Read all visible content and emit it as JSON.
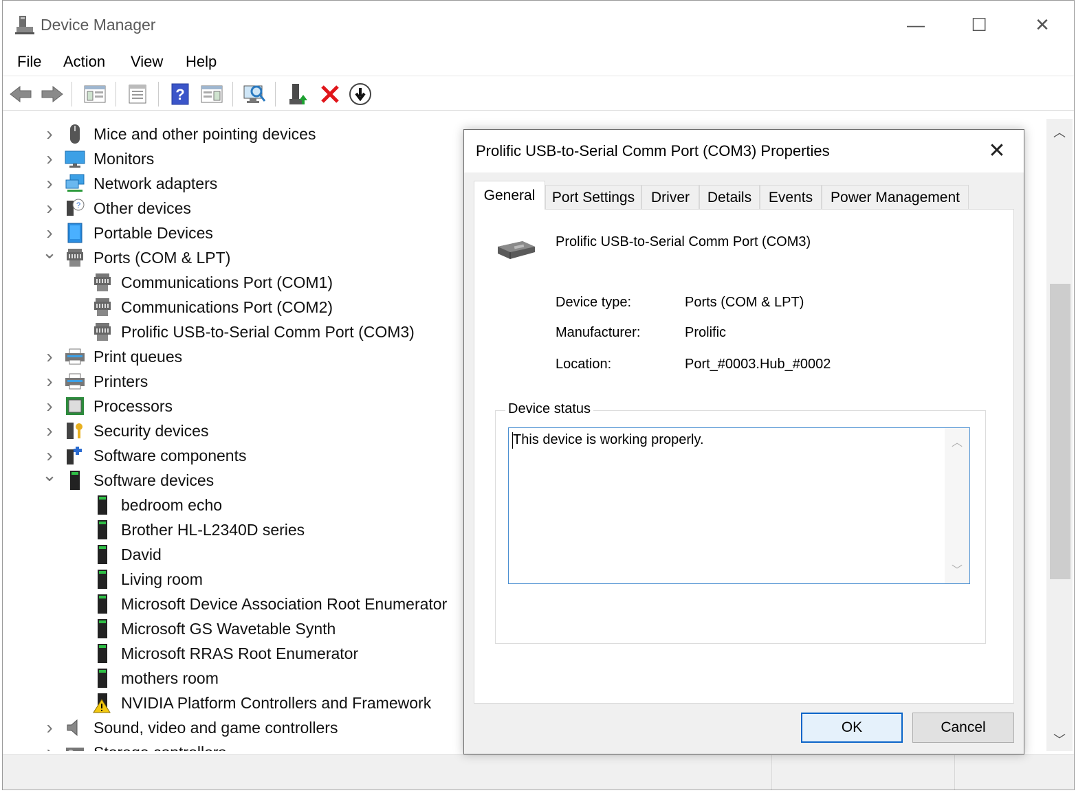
{
  "window": {
    "title": "Device Manager",
    "controls": {
      "minimize": "—",
      "maximize": "☐",
      "close": "✕"
    }
  },
  "menu": {
    "file": "File",
    "action": "Action",
    "view": "View",
    "help": "Help"
  },
  "toolbar": {
    "icons": [
      "back-icon",
      "forward-icon",
      "show-hide-console-tree-icon",
      "properties-icon",
      "help-icon",
      "action-pane-icon",
      "scan-hardware-icon",
      "update-driver-icon",
      "uninstall-icon",
      "disable-device-icon"
    ]
  },
  "tree": {
    "items": [
      {
        "label": "Mice and other pointing devices",
        "expanded": false,
        "icon": "mouse-icon"
      },
      {
        "label": "Monitors",
        "expanded": false,
        "icon": "monitor-icon"
      },
      {
        "label": "Network adapters",
        "expanded": false,
        "icon": "network-icon"
      },
      {
        "label": "Other devices",
        "expanded": false,
        "icon": "unknown-device-icon"
      },
      {
        "label": "Portable Devices",
        "expanded": false,
        "icon": "portable-device-icon"
      },
      {
        "label": "Ports (COM & LPT)",
        "expanded": true,
        "icon": "port-icon"
      },
      {
        "label": "Communications Port (COM1)",
        "child": true,
        "icon": "port-icon"
      },
      {
        "label": "Communications Port (COM2)",
        "child": true,
        "icon": "port-icon"
      },
      {
        "label": "Prolific USB-to-Serial Comm Port (COM3)",
        "child": true,
        "icon": "port-icon"
      },
      {
        "label": "Print queues",
        "expanded": false,
        "icon": "printer-icon"
      },
      {
        "label": "Printers",
        "expanded": false,
        "icon": "printer-icon"
      },
      {
        "label": "Processors",
        "expanded": false,
        "icon": "processor-icon"
      },
      {
        "label": "Security devices",
        "expanded": false,
        "icon": "security-icon"
      },
      {
        "label": "Software components",
        "expanded": false,
        "icon": "software-component-icon"
      },
      {
        "label": "Software devices",
        "expanded": true,
        "icon": "software-device-icon"
      },
      {
        "label": "bedroom echo",
        "child": true,
        "icon": "software-device-icon"
      },
      {
        "label": "Brother HL-L2340D series",
        "child": true,
        "icon": "software-device-icon"
      },
      {
        "label": "David",
        "child": true,
        "icon": "software-device-icon"
      },
      {
        "label": "Living room",
        "child": true,
        "icon": "software-device-icon"
      },
      {
        "label": "Microsoft Device Association Root Enumerator",
        "child": true,
        "icon": "software-device-icon"
      },
      {
        "label": "Microsoft GS Wavetable Synth",
        "child": true,
        "icon": "software-device-icon"
      },
      {
        "label": "Microsoft RRAS Root Enumerator",
        "child": true,
        "icon": "software-device-icon"
      },
      {
        "label": "mothers room",
        "child": true,
        "icon": "software-device-icon"
      },
      {
        "label": "NVIDIA Platform Controllers and Framework",
        "child": true,
        "icon": "warning-icon"
      },
      {
        "label": "Sound, video and game controllers",
        "expanded": false,
        "icon": "speaker-icon"
      },
      {
        "label": "Storage controllers",
        "expanded": false,
        "icon": "storage-icon"
      }
    ]
  },
  "dialog": {
    "title": "Prolific USB-to-Serial Comm Port (COM3) Properties",
    "close": "✕",
    "tabs": [
      "General",
      "Port Settings",
      "Driver",
      "Details",
      "Events",
      "Power Management"
    ],
    "active_tab": "General",
    "device_name": "Prolific USB-to-Serial Comm Port (COM3)",
    "props": {
      "device_type_label": "Device type:",
      "device_type_value": "Ports (COM & LPT)",
      "manufacturer_label": "Manufacturer:",
      "manufacturer_value": "Prolific",
      "location_label": "Location:",
      "location_value": "Port_#0003.Hub_#0002"
    },
    "status_label": "Device status",
    "status_text": "This device is working properly.",
    "ok": "OK",
    "cancel": "Cancel"
  },
  "colors": {
    "accent": "#0a64c8",
    "focus_border": "#4a8fd1",
    "dialog_bg": "#f0f0f0"
  }
}
